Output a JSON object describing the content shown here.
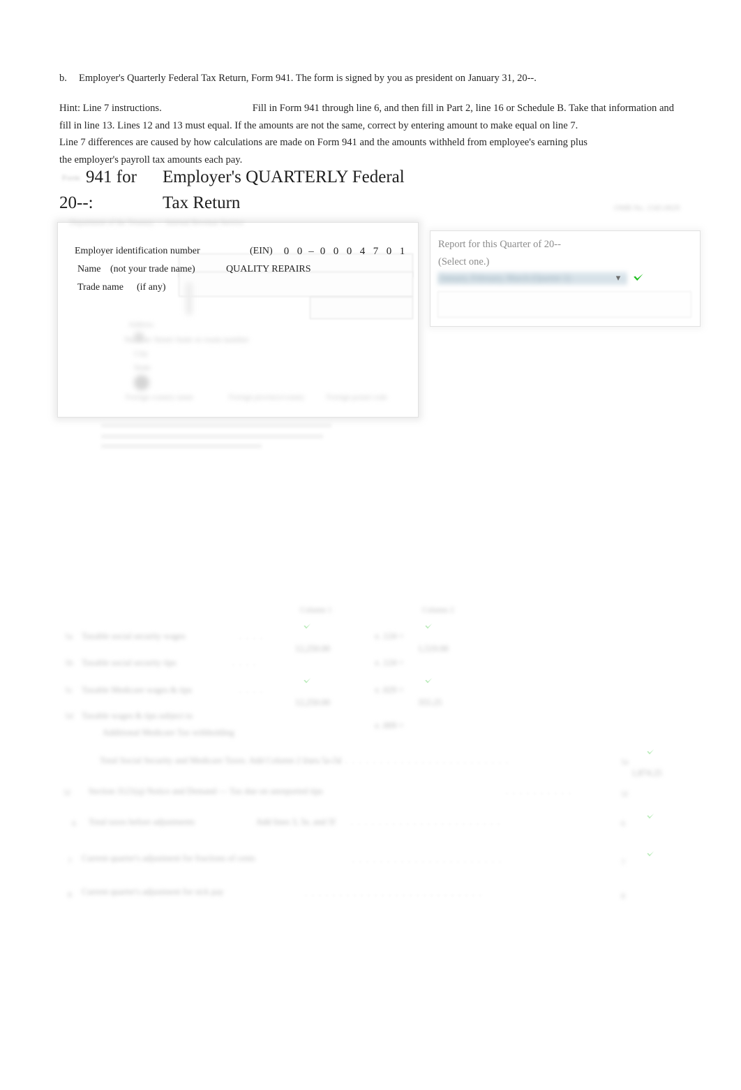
{
  "instructions": {
    "item": {
      "letter": "b.",
      "text": "Employer's Quarterly Federal Tax Return, Form 941. The form is signed by you as president on January 31, 20--."
    },
    "hint": {
      "label": "Hint: Line 7 instructions.",
      "line1": "Fill in Form 941 through line 6, and then fill in Part 2, line 16 or Schedule B. Take that information and",
      "line2": "fill in line 13. Lines 12 and 13 must equal. If the amounts are not the same, correct by entering amount to make equal on line 7.",
      "line3": "Line 7 differences are caused by how calculations are made on Form 941 and the amounts withheld from employee's earning plus",
      "line4": "the employer's payroll tax amounts each pay."
    }
  },
  "form_header": {
    "form_word": "Form",
    "form_number": "941 for",
    "year_label": "20--:",
    "title_line1": "Employer's QUARTERLY Federal",
    "title_line2": "Tax Return",
    "omb_corner": "OMB No. 1545-0029"
  },
  "form_box": {
    "blurred_top_strip": "Department of the Treasury — Internal Revenue Service",
    "ein": {
      "label": "Employer identification number",
      "paren": "(EIN)",
      "digits": [
        "0",
        "0",
        "–",
        "0",
        "0",
        "0",
        "4",
        "7",
        "0",
        "1"
      ]
    },
    "name": {
      "label": "Name",
      "sublabel": "(not your trade name)",
      "value": "QUALITY REPAIRS"
    },
    "trade_name": {
      "label": "Trade name",
      "sublabel": "(if any)"
    },
    "address_blurred": {
      "header": "Address",
      "line1": "Number   Street   Suite or room number",
      "line2": "City",
      "line3": "State",
      "footer1": "Foreign country name",
      "footer2": "Foreign province/county",
      "footer3": "Foreign postal code"
    }
  },
  "quarter_panel": {
    "title": "Report for this Quarter of 20--",
    "subtitle": "(Select one.)",
    "selected_option": "January, February, March (Quarter 1)",
    "caret_icon": "chevron-down-icon",
    "check_icon": "green-check-icon",
    "check_color": "#1fc01f"
  },
  "lines_table": {
    "column_headers": [
      "Column 1",
      "Column 2"
    ],
    "rows": [
      {
        "num": "5a",
        "label": "Taxable social security wages",
        "col1": "12,250.00",
        "mid": "x .124 =",
        "col2": "1,519.00",
        "has_check_col1": true,
        "has_check_col2": true
      },
      {
        "num": "5b",
        "label": "Taxable social security tips",
        "col1": "",
        "mid": "x .124 =",
        "col2": "",
        "has_check_col1": false,
        "has_check_col2": false
      },
      {
        "num": "5c",
        "label": "Taxable Medicare wages & tips",
        "col1": "12,250.00",
        "mid": "x .029 =",
        "col2": "355.25",
        "has_check_col1": true,
        "has_check_col2": true
      },
      {
        "num": "5d",
        "label": "Taxable wages & tips subject to",
        "label2": "Additional Medicare Tax withholding",
        "col1": "",
        "mid": "x .009 =",
        "col2": "",
        "has_check_col1": false,
        "has_check_col2": false
      }
    ],
    "totals": [
      {
        "num": "5e",
        "label": "Total Social Security and Medicare Taxes. Add Column 2 lines 5a-5d",
        "value": "1,874.25",
        "right_num": "5e",
        "has_check": true
      },
      {
        "num": "5f",
        "label": "Section 3121(q) Notice and Demand — Tax due on unreported tips",
        "value": "",
        "right_num": "5f",
        "has_check": false
      },
      {
        "num": "6",
        "label": "Total taxes before adjustments",
        "mid": "Add lines 3, 5e, and 5f",
        "value": "",
        "right_num": "6",
        "has_check": true
      },
      {
        "num": "7",
        "label": "Current quarter's adjustment for fractions of cents",
        "value": "",
        "right_num": "7",
        "has_check": true
      },
      {
        "num": "8",
        "label": "Current quarter's adjustment for sick pay",
        "value": "",
        "right_num": "8",
        "has_check": false
      }
    ]
  }
}
